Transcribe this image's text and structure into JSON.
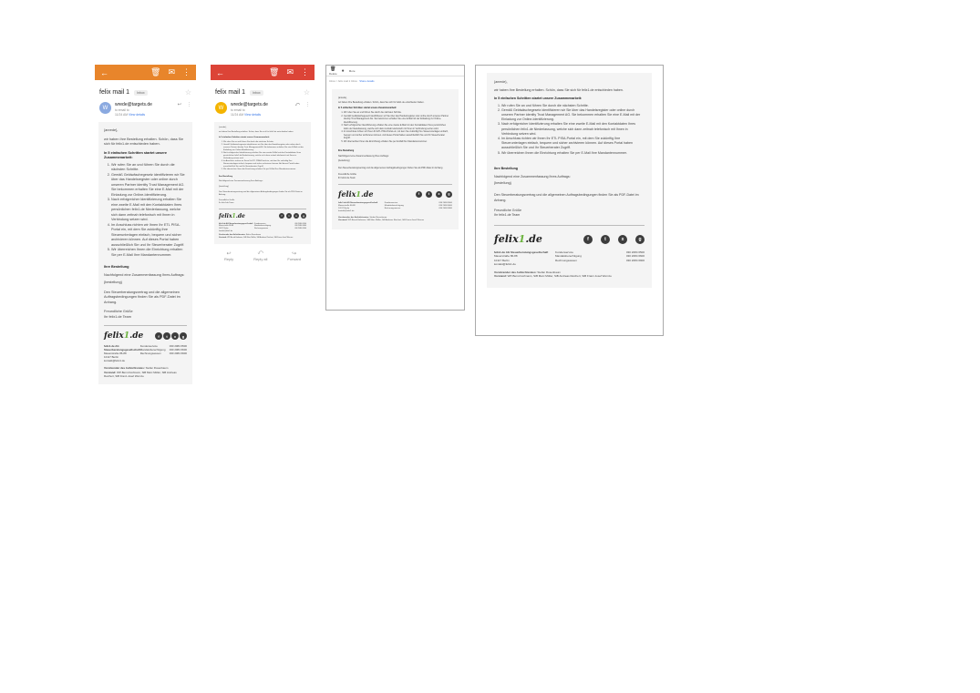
{
  "colors": {
    "orange": "#e8852b",
    "red": "#dc4437",
    "green": "#6cb33f",
    "link": "#3b78e7",
    "avatar": "#8aa9e0",
    "avatar2": "#f4b400"
  },
  "icons": {
    "back": "arrow-left-icon",
    "trash": "trash-icon",
    "mail": "mail-icon",
    "more": "more-vertical-icon"
  },
  "mobile": {
    "subject": "felix mail 1",
    "tag": "Inbox",
    "sender": "wrede@targets.de",
    "to": "to email to",
    "date": "11/24 AM View details",
    "date_short": "11/24 AM",
    "details": "View details",
    "avatar_letter": "W",
    "avatar_letter2": "W"
  },
  "mail": {
    "greeting": "{anrede},",
    "intro": "wir haben Ihre Bestellung erhalten. Schön, dass Sie sich für felix1.de entschieden haben.",
    "heading": "In 5 einfachen Schritten startet unsere Zusammenarbeit:",
    "steps": [
      "Wir rufen Sie an und führen Sie durch die nächsten Schritte.",
      "Gemäß Geldwäschegesetz identifizieren wir Sie über das Handelsregister oder online durch unseren Partner identity Trust Management AG. Sie bekommen erhalten Sie eine E-Mail mit der Einladung zur Online-Identifizierung.",
      "Nach erfolgreicher Identifizierung erhalten Sie eine zweite E-Mail mit den Kontaktdaten Ihres persönlichen felix1.de Niederlassung, welche sich dann zeitnah telefonisch mit Ihnen in Verbindung setzen wird.",
      "Im Anschluss richten wir Ihnen Ihr ETL PISA-Portal ein, mit dem Sie zukünftig Ihre Steuerunterlagen einfach, bequem und sicher archivieren können. Auf dieses Portal haben ausschließlich Sie und Ihr Steuerberater Zugriff.",
      "Wir überreichen Ihnen die Einrichtung erhalten Sie per E-Mail Ihre Mandantennummer."
    ],
    "order_title": "Ihre Bestellung",
    "order_text": "Nachfolgend eine Zusammenfassung Ihres Auftrags:",
    "order_var": "{bestellung}",
    "contract": "Den Steuerberatungsvertrag und die allgemeinen Auftragsbedingungen finden Sie als PDF-Datei im Anhang.",
    "closing": "Freundliche Grüße",
    "team": "Ihr felix1.de Team",
    "logo_a": "felix",
    "logo_b": "1",
    "logo_c": ".de",
    "social": [
      "f",
      "t",
      "x",
      "g"
    ],
    "company": "felix1.de AG Steuerberatungsgesellschaft",
    "street": "Mauerstraße 86-88",
    "city": "10117 Berlin",
    "mail": "kontakt@felix1.de",
    "contact_labels": [
      "Kundenservice",
      "Mandatsberechtigung",
      "Rechnungswesen"
    ],
    "phones": [
      "030 2084 6500",
      "030 2084 6600",
      "030 2084 6900"
    ],
    "board_label": "Vorsitzender des Aufsichtsrates:",
    "board_name": "Stefan Rosenbaum",
    "vorstand_label": "Vorstand:",
    "vorstand_names": "WP-Bernd Hofmann, StB Marc Müller, StB Andreas Reichert, StB Franz-Josef Wernze"
  },
  "nav": {
    "reply": "Reply",
    "reply_all": "Reply all",
    "forward": "Forward"
  },
  "outlook": {
    "del": "Delete",
    "more": "More",
    "crumb_a": "Inbox > felix mail 1 Inbox",
    "crumb_b": "Share details"
  }
}
